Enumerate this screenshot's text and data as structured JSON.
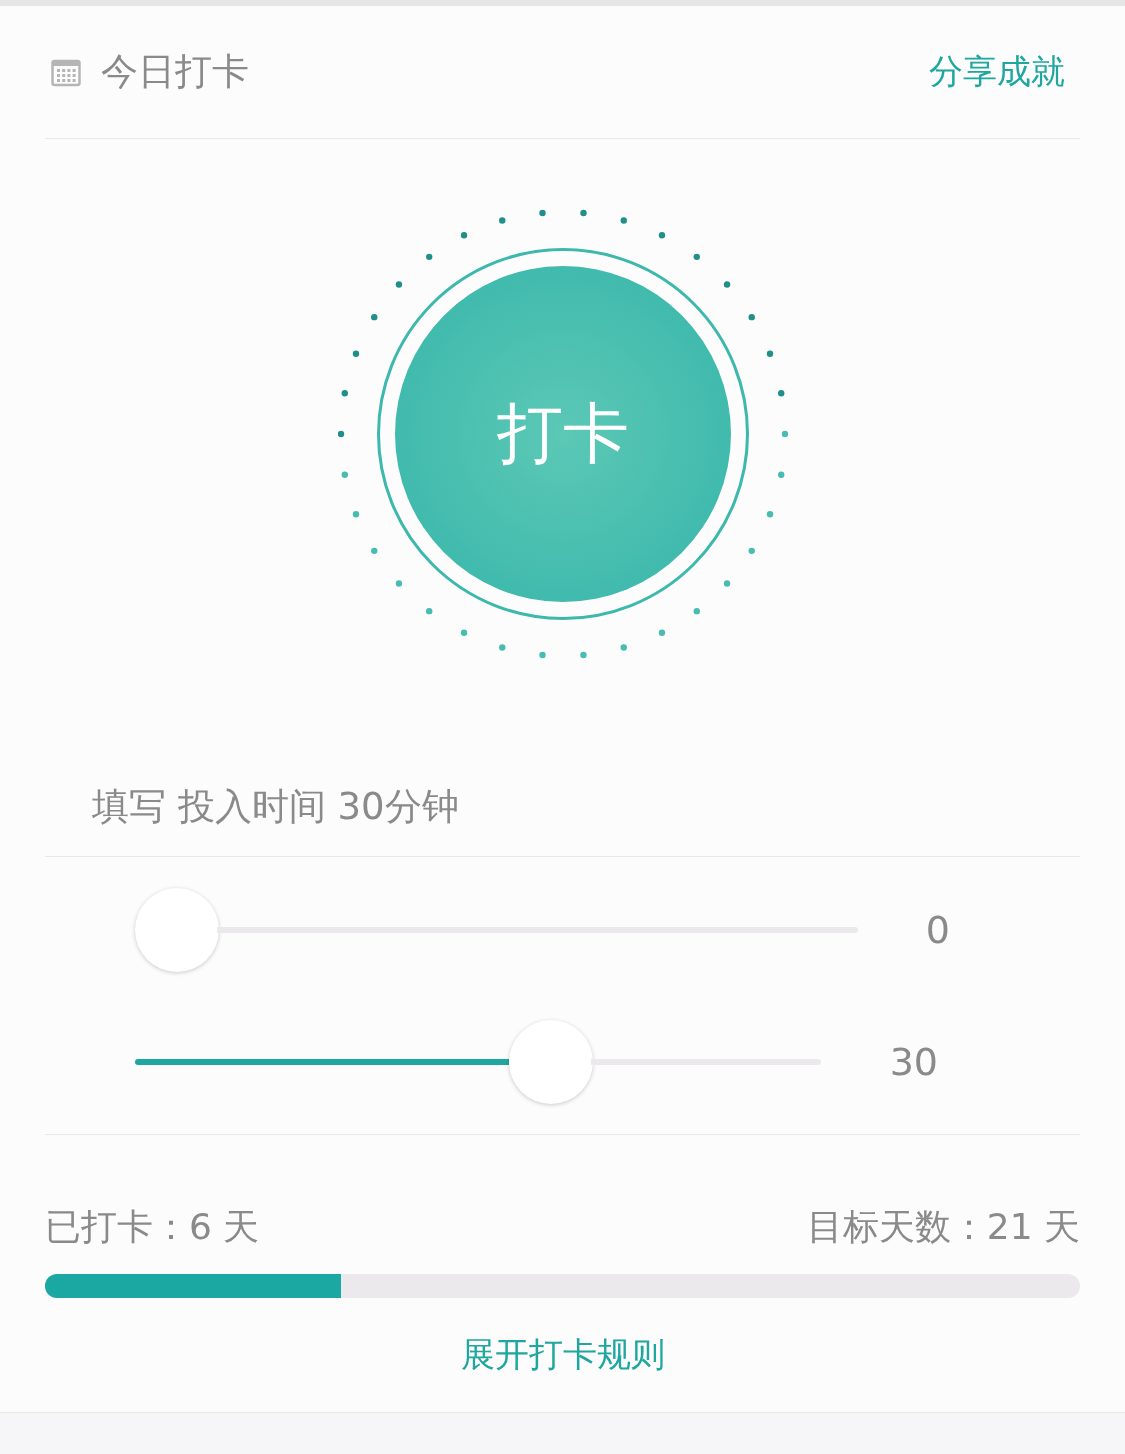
{
  "header": {
    "title": "今日打卡",
    "share_link": "分享成就"
  },
  "checkin_button": {
    "label": "打卡"
  },
  "time_entry": {
    "text": "填写 投入时间 30分钟"
  },
  "sliders": [
    {
      "level": 0,
      "reading": "0"
    },
    {
      "level": 0.545,
      "reading": "30"
    }
  ],
  "progress": {
    "checked_in": "已打卡：6 天",
    "goal": "目标天数：21 天",
    "level": 0.286
  },
  "rules_link": "展开打卡规则"
}
